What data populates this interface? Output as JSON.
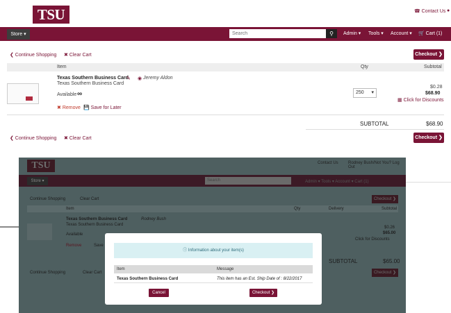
{
  "header": {
    "logo": "TSU",
    "contact": "☎ Contact Us"
  },
  "nav": {
    "store": "Store ▾",
    "search_placeholder": "Search",
    "admin": "Admin ▾",
    "tools": "Tools ▾",
    "account": "Account ▾",
    "cart": "🛒 Cart (1)"
  },
  "actions": {
    "continue": "❮ Continue Shopping",
    "clear": "✖ Clear Cart",
    "checkout": "Checkout ❯"
  },
  "table": {
    "col_item": "Item",
    "col_qty": "Qty",
    "col_subtotal": "Subtotal"
  },
  "cart_item": {
    "name": "Texas Southern Business Card",
    "user": "Jeremy Aldon",
    "desc": "Texas Southern Business Card",
    "available": "Available",
    "remove": "Remove",
    "save_later": "Save for Later",
    "qty": "250",
    "unit_price": "$0.28",
    "line_total": "$68.90",
    "discounts": "Click for Discounts"
  },
  "summary": {
    "label": "SUBTOTAL",
    "value": "$68.90"
  },
  "overlay": {
    "logo": "TSU",
    "top_links": "Contact Us",
    "user_line": "Rodney Bush/Not You? Log Out",
    "store": "Store ▾",
    "search": "Search",
    "nav_links": "Admin ▾   Tools ▾   Account ▾   Cart (1)",
    "continue": "Continue Shopping",
    "clear": "Clear Cart",
    "checkout": "Checkout ❯",
    "col_item": "Item",
    "col_qty": "Qty",
    "col_delivery": "Delivery",
    "col_subtotal": "Subtotal",
    "item_name": "Texas Southern Business Card",
    "item_user": "Rodney Bush",
    "item_desc": "Texas Southern Business Card",
    "available": "Available",
    "remove": "Remove",
    "save": "Save",
    "unit": "$0.26",
    "total": "$65.00",
    "discounts": "Click for Discounts",
    "subtotal_label": "SUBTOTAL",
    "subtotal_value": "$65.00"
  },
  "modal": {
    "title": "Information about your item(s)",
    "col_item": "Item",
    "col_message": "Message",
    "row_item": "Texas Southern Business Card",
    "row_message": "This item has an Est. Ship Date of : 8/22/2017",
    "cancel": "Cancel",
    "checkout": "Checkout ❯"
  }
}
